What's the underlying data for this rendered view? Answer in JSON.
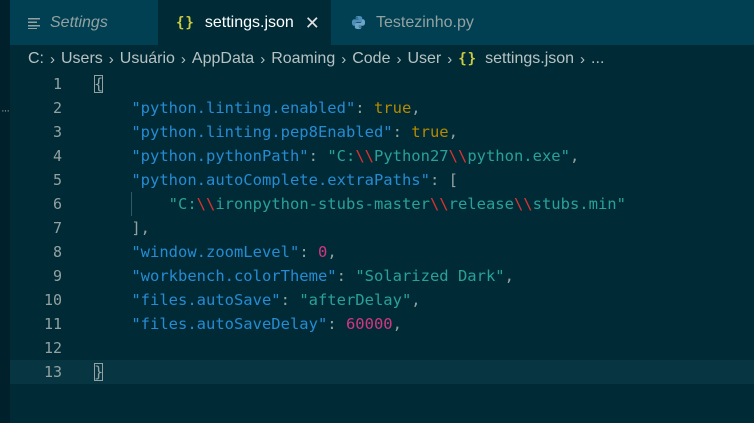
{
  "tabs": [
    {
      "label": "Settings",
      "icon": "hamburger-icon"
    },
    {
      "label": "settings.json",
      "icon": "json-braces-icon",
      "close": "✕"
    },
    {
      "label": "Testezinho.py",
      "icon": "python-icon"
    }
  ],
  "breadcrumb": [
    "C:",
    "Users",
    "Usuário",
    "AppData",
    "Roaming",
    "Code",
    "User",
    "settings.json",
    "..."
  ],
  "editor": {
    "line_numbers": [
      "1",
      "2",
      "3",
      "4",
      "5",
      "6",
      "7",
      "8",
      "9",
      "10",
      "11",
      "12",
      "13"
    ],
    "lines": [
      [
        {
          "t": "p",
          "v": "{"
        }
      ],
      [
        {
          "t": "k",
          "v": "    \"python.linting.enabled\""
        },
        {
          "t": "p",
          "v": ": "
        },
        {
          "t": "b",
          "v": "true"
        },
        {
          "t": "p",
          "v": ","
        }
      ],
      [
        {
          "t": "k",
          "v": "    \"python.linting.pep8Enabled\""
        },
        {
          "t": "p",
          "v": ": "
        },
        {
          "t": "b",
          "v": "true"
        },
        {
          "t": "p",
          "v": ","
        }
      ],
      [
        {
          "t": "k",
          "v": "    \"python.pythonPath\""
        },
        {
          "t": "p",
          "v": ": "
        },
        {
          "t": "s",
          "v": "\"C:"
        },
        {
          "t": "esc",
          "v": "\\\\"
        },
        {
          "t": "s",
          "v": "Python27"
        },
        {
          "t": "esc",
          "v": "\\\\"
        },
        {
          "t": "s",
          "v": "python.exe\""
        },
        {
          "t": "p",
          "v": ","
        }
      ],
      [
        {
          "t": "k",
          "v": "    \"python.autoComplete.extraPaths\""
        },
        {
          "t": "p",
          "v": ": ["
        }
      ],
      [
        {
          "t": "s",
          "v": "        \"C:"
        },
        {
          "t": "esc",
          "v": "\\\\"
        },
        {
          "t": "s",
          "v": "ironpython-stubs-master"
        },
        {
          "t": "esc",
          "v": "\\\\"
        },
        {
          "t": "s",
          "v": "release"
        },
        {
          "t": "esc",
          "v": "\\\\"
        },
        {
          "t": "s",
          "v": "stubs.min\""
        }
      ],
      [
        {
          "t": "p",
          "v": "    ],"
        }
      ],
      [
        {
          "t": "k",
          "v": "    \"window.zoomLevel\""
        },
        {
          "t": "p",
          "v": ": "
        },
        {
          "t": "n",
          "v": "0"
        },
        {
          "t": "p",
          "v": ","
        }
      ],
      [
        {
          "t": "k",
          "v": "    \"workbench.colorTheme\""
        },
        {
          "t": "p",
          "v": ": "
        },
        {
          "t": "s",
          "v": "\"Solarized Dark\""
        },
        {
          "t": "p",
          "v": ","
        }
      ],
      [
        {
          "t": "k",
          "v": "    \"files.autoSave\""
        },
        {
          "t": "p",
          "v": ": "
        },
        {
          "t": "s",
          "v": "\"afterDelay\""
        },
        {
          "t": "p",
          "v": ","
        }
      ],
      [
        {
          "t": "k",
          "v": "    \"files.autoSaveDelay\""
        },
        {
          "t": "p",
          "v": ": "
        },
        {
          "t": "n",
          "v": "60000"
        },
        {
          "t": "p",
          "v": ","
        }
      ],
      [],
      [
        {
          "t": "p",
          "v": "}"
        }
      ]
    ],
    "current_line": 13
  },
  "colors": {
    "editor_bg": "#002b36",
    "tab_inactive_bg": "#004052",
    "key": "#268bd2",
    "string": "#2aa198",
    "boolean": "#b58900",
    "number": "#d33682",
    "escape": "#dc322f"
  }
}
